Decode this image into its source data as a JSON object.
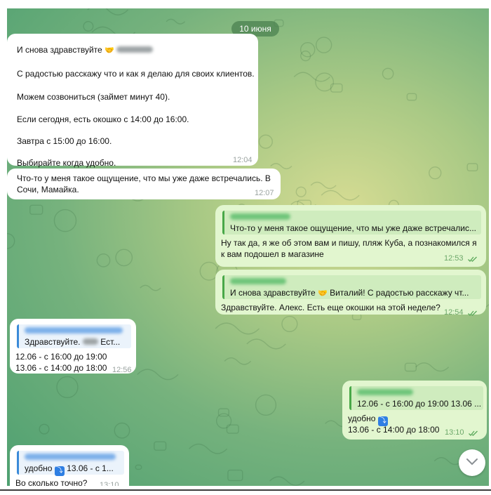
{
  "date_label": "10 июня",
  "colors": {
    "incoming": "#ffffff",
    "outgoing": "#e2f6cf",
    "accent_green": "#48a848",
    "accent_blue": "#3a8ad8"
  },
  "messages": [
    {
      "id": "m1",
      "direction": "in",
      "lines": [
        "И снова здравствуйте",
        "С радостью расскажу что и как я делаю для своих клиентов.",
        "Можем созвониться (займет минут 40).",
        "Если сегодня, есть окошко с 14:00 до 16:00.",
        "Завтра с 15:00 до 16:00.",
        "Выбирайте когда удобно."
      ],
      "time": "12:04"
    },
    {
      "id": "m2",
      "direction": "in",
      "lines": [
        "Что-то у меня такое ощущение, что мы уже даже встречались. В",
        "Сочи, Мамайка."
      ],
      "time": "12:07"
    },
    {
      "id": "m3",
      "direction": "out",
      "quote": "Что-то у меня такое ощущение, что мы уже даже встречалис...",
      "lines": [
        "Ну так да, я же об этом вам и пишу, пляж Куба, а познакомился я",
        "к вам подошел в магазине"
      ],
      "time": "12:53"
    },
    {
      "id": "m4",
      "direction": "out",
      "quote_a": "И снова здравствуйте",
      "quote_b": "Виталий!   С радостью расскажу чт...",
      "lines": [
        "Здравствуйте. Алекс. Есть еще окошки на этой неделе?"
      ],
      "time": "12:54"
    },
    {
      "id": "m5",
      "direction": "in",
      "quote_a": "Здравствуйте.",
      "quote_b": "Ест...",
      "lines": [
        "12.06 - с 16:00 до 19:00",
        "13.06 - с 14:00 до 18:00"
      ],
      "time": "12:56"
    },
    {
      "id": "m6",
      "direction": "out",
      "quote": "12.06 - с 16:00 до 19:00 13.06 ...",
      "line_a": "удобно",
      "line_b": "13.06 - с 14:00 до 18:00",
      "time": "13:10"
    },
    {
      "id": "m7",
      "direction": "in",
      "quote_a": "удобно",
      "quote_b": "13.06 - с 1...",
      "lines": [
        "Во сколько точно?"
      ],
      "time": "13:10"
    }
  ],
  "icons": {
    "handshake": "🤝",
    "arrow_down_badge": "⤵",
    "scroll_down": "chevron-down-icon",
    "read_receipt": "double-check-icon"
  }
}
